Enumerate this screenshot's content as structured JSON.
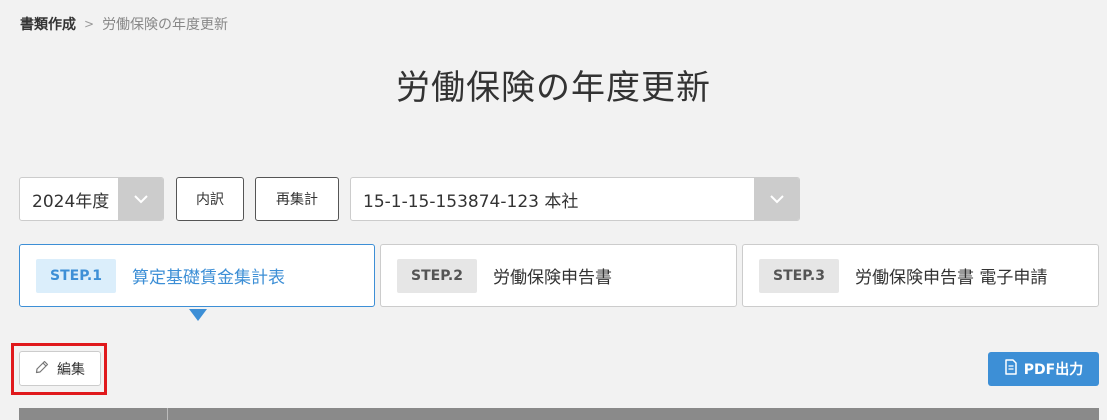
{
  "breadcrumb": {
    "parent": "書類作成",
    "separator": ">",
    "current": "労働保険の年度更新"
  },
  "page_title": "労働保険の年度更新",
  "filters": {
    "year_select": {
      "value": "2024年度"
    },
    "breakdown_button": "内訳",
    "recalc_button": "再集計",
    "office_select": {
      "value": "15-1-15-153874-123 本社"
    }
  },
  "steps": [
    {
      "badge": "STEP.1",
      "label": "算定基礎賃金集計表",
      "active": true
    },
    {
      "badge": "STEP.2",
      "label": "労働保険申告書",
      "active": false
    },
    {
      "badge": "STEP.3",
      "label": "労働保険申告書 電子申請",
      "active": false
    }
  ],
  "actions": {
    "edit_button": "編集",
    "edit_icon": "pencil-icon",
    "pdf_button": "PDF出力",
    "pdf_icon": "document-icon"
  },
  "colors": {
    "accent": "#3d8fd6",
    "highlight": "#e0191c",
    "background": "#f2f2f2"
  }
}
